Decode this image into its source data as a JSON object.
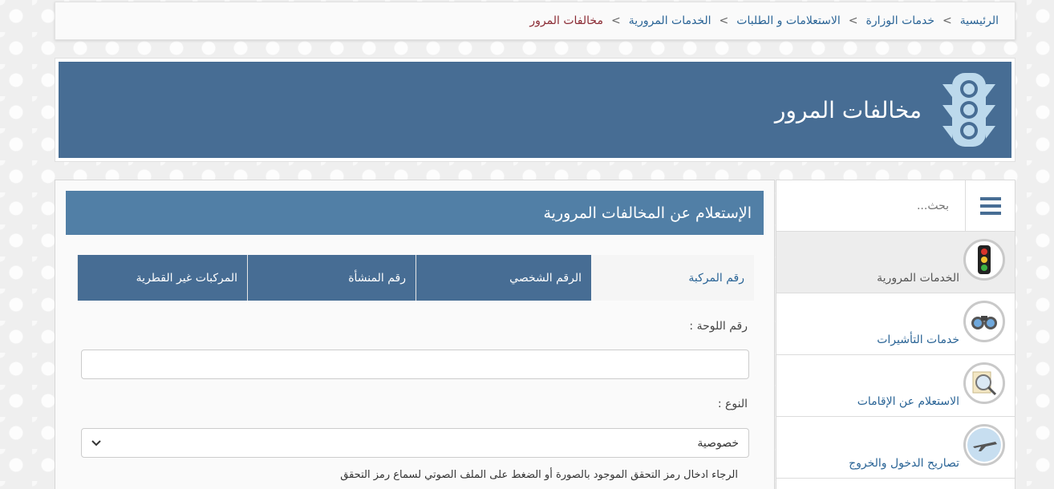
{
  "breadcrumb": {
    "items": [
      "الرئيسية",
      "خدمات الوزارة",
      "الاستعلامات و الطلبات",
      "الخدمات المرورية"
    ],
    "current": "مخالفات المرور",
    "separator": ">"
  },
  "banner": {
    "title": "مخالفات المرور",
    "icon": "traffic-light-icon",
    "color": "#476d94"
  },
  "sidebar": {
    "search_placeholder": "بحث...",
    "items": [
      {
        "label": "الخدمات المرورية",
        "icon": "traffic-light-icon",
        "active": true
      },
      {
        "label": "خدمات التأشيرات",
        "icon": "binoculars-icon",
        "active": false
      },
      {
        "label": "الاستعلام عن الإقامات",
        "icon": "magnifier-icon",
        "active": false
      },
      {
        "label": "تصاريح الدخول والخروج",
        "icon": "airplane-icon",
        "active": false
      }
    ]
  },
  "main": {
    "header": "الإستعلام عن المخالفات المرورية",
    "header_color": "#517fa6",
    "tabs": [
      {
        "label": "رقم المركبة",
        "active": true
      },
      {
        "label": "الرقم الشخصي",
        "active": false
      },
      {
        "label": "رقم المنشأة",
        "active": false
      },
      {
        "label": "المركبات غير القطرية",
        "active": false
      }
    ],
    "plate_label": "رقم اللوحة :",
    "plate_value": "",
    "type_label": "النوع :",
    "type_selected": "خصوصية",
    "captcha_help": "الرجاء ادخال رمز التحقق الموجود بالصورة أو الضغط على الملف الصوتي لسماع رمز التحقق"
  }
}
